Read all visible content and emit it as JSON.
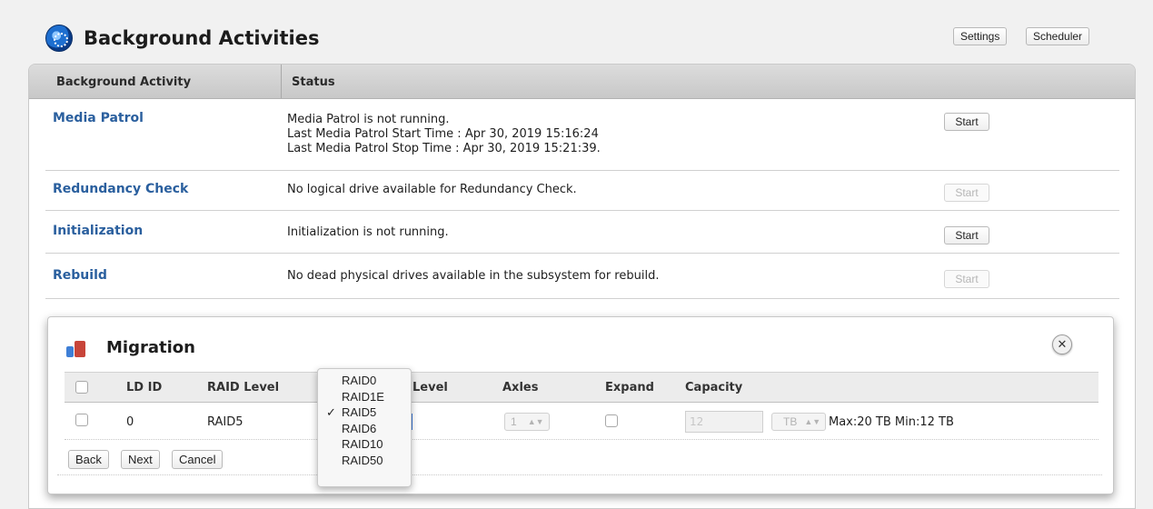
{
  "page": {
    "title": "Background Activities",
    "settings_label": "Settings",
    "scheduler_label": "Scheduler"
  },
  "table": {
    "headers": [
      "Background Activity",
      "Status"
    ],
    "rows": [
      {
        "activity": "Media Patrol",
        "status": [
          "Media Patrol is not running.",
          "Last Media Patrol Start Time : Apr 30, 2019 15:16:24",
          "Last Media Patrol Stop Time : Apr 30, 2019 15:21:39."
        ],
        "button": "Start",
        "enabled": true
      },
      {
        "activity": "Redundancy Check",
        "status": [
          "No logical drive available for Redundancy Check."
        ],
        "button": "Start",
        "enabled": false
      },
      {
        "activity": "Initialization",
        "status": [
          "Initialization is not running."
        ],
        "button": "Start",
        "enabled": true
      },
      {
        "activity": "Rebuild",
        "status": [
          "No dead physical drives available in the subsystem for rebuild."
        ],
        "button": "Start",
        "enabled": false
      }
    ]
  },
  "migration": {
    "title": "Migration",
    "close_icon": "close-icon",
    "headers": {
      "ld_id": "LD ID",
      "raid_level": "RAID Level",
      "target_level": "Level",
      "axles": "Axles",
      "expand": "Expand",
      "capacity": "Capacity"
    },
    "row": {
      "ld_id": "0",
      "raid_level": "RAID5",
      "axles": "1",
      "capacity_value": "12",
      "capacity_unit": "TB",
      "max_min": "Max:20 TB Min:12 TB"
    },
    "buttons": {
      "back": "Back",
      "next": "Next",
      "cancel": "Cancel"
    },
    "dropdown": {
      "options": [
        "RAID0",
        "RAID1E",
        "RAID5",
        "RAID6",
        "RAID10",
        "RAID50"
      ],
      "selected": "RAID5",
      "check": "✓"
    }
  },
  "colors": {
    "link": "#2a5f9e",
    "header_bg": "#d0d0d0"
  }
}
